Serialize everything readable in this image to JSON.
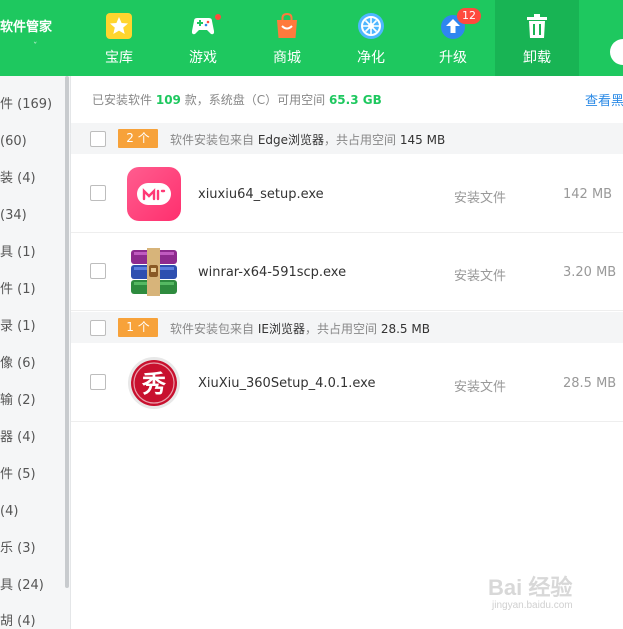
{
  "app": {
    "brand": "软件管家",
    "brand_sub": "ˇ"
  },
  "nav": [
    {
      "label": "宝库",
      "icon": "star-icon"
    },
    {
      "label": "游戏",
      "icon": "gamepad-icon",
      "dot": true
    },
    {
      "label": "商城",
      "icon": "shopping-bag-icon"
    },
    {
      "label": "净化",
      "icon": "purify-icon"
    },
    {
      "label": "升级",
      "icon": "upgrade-arrow-icon",
      "badge": "12"
    },
    {
      "label": "卸载",
      "icon": "trash-icon",
      "active": true
    }
  ],
  "sidebar": {
    "items": [
      {
        "label": "件 (169)"
      },
      {
        "label": "(60)"
      },
      {
        "label": "装 (4)"
      },
      {
        "label": "(34)"
      },
      {
        "label": "具 (1)"
      },
      {
        "label": "件 (1)"
      },
      {
        "label": "录 (1)"
      },
      {
        "label": "像 (6)"
      },
      {
        "label": "输 (2)"
      },
      {
        "label": "器 (4)"
      },
      {
        "label": "件 (5)"
      },
      {
        "label": "(4)"
      },
      {
        "label": "乐 (3)"
      },
      {
        "label": "具 (24)"
      },
      {
        "label": "胡 (4)"
      }
    ]
  },
  "summary": {
    "prefix": "已安装软件",
    "count": "109",
    "mid": "款，系统盘（C）可用空间",
    "free": "65.3 GB"
  },
  "view_link": "查看黑",
  "groups": [
    {
      "count": "2 个",
      "source_prefix": "软件安装包来自",
      "source": "Edge浏览器",
      "space_prefix": "，共占用空间",
      "space": "145 MB",
      "files": [
        {
          "name": "xiuxiu64_setup.exe",
          "type": "安装文件",
          "size": "142 MB",
          "icon": "meitu-app-icon"
        },
        {
          "name": "winrar-x64-591scp.exe",
          "type": "安装文件",
          "size": "3.20 MB",
          "icon": "winrar-books-icon"
        }
      ]
    },
    {
      "count": "1 个",
      "source_prefix": "软件安装包来自",
      "source": "IE浏览器",
      "space_prefix": "，共占用空间",
      "space": "28.5 MB",
      "files": [
        {
          "name": "XiuXiu_360Setup_4.0.1.exe",
          "type": "安装文件",
          "size": "28.5 MB",
          "icon": "xiu-app-icon"
        }
      ]
    }
  ],
  "watermark": {
    "main": "Bai 经验",
    "sub": "jingyan.baidu.com"
  },
  "colors": {
    "brand_green": "#1ec85f",
    "badge_orange": "#f7a23a",
    "link_blue": "#2b8ae6",
    "alert_red": "#ff4a3d"
  }
}
